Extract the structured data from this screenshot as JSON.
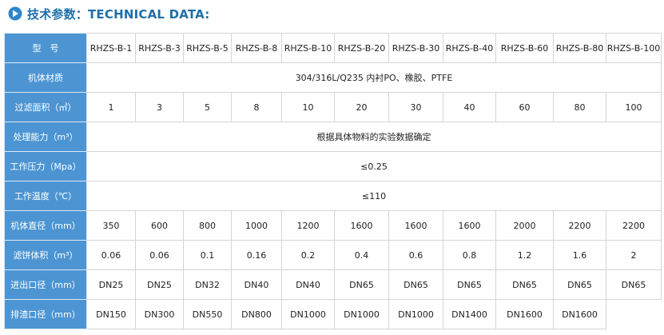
{
  "header": {
    "title": "技术参数：TECHNICAL DATA:",
    "icon": "arrow-right-circle-icon",
    "accent_color": "#1e6fa8"
  },
  "table": {
    "label_bg": "#4d95d2",
    "rows": [
      {
        "label": "型　号",
        "span": false,
        "values": [
          "RHZS-B-1",
          "RHZS-B-3",
          "RHZS-B-5",
          "RHZS-B-8",
          "RHZS-B-10",
          "RHZS-B-20",
          "RHZS-B-30",
          "RHZS-B-40",
          "RHZS-B-60",
          "RHZS-B-80",
          "RHZS-B-100"
        ]
      },
      {
        "label": "机体材质",
        "span": true,
        "value": "304/316L/Q235  内衬PO、橡胶、PTFE"
      },
      {
        "label": "过滤面积（㎡）",
        "span": false,
        "values": [
          "1",
          "3",
          "5",
          "8",
          "10",
          "20",
          "30",
          "40",
          "60",
          "80",
          "100"
        ]
      },
      {
        "label": "处理能力（m³）",
        "span": true,
        "value": "根据具体物料的实验数据确定"
      },
      {
        "label": "工作压力（Mpa）",
        "span": true,
        "value": "≤0.25"
      },
      {
        "label": "工作温度（℃）",
        "span": true,
        "value": "≤110"
      },
      {
        "label": "机体直径（mm）",
        "span": false,
        "values": [
          "350",
          "600",
          "800",
          "1000",
          "1200",
          "1600",
          "1600",
          "1600",
          "2000",
          "2200",
          "2200"
        ]
      },
      {
        "label": "滤饼体积（m³）",
        "span": false,
        "values": [
          "0.06",
          "0.06",
          "0.1",
          "0.16",
          "0.2",
          "0.4",
          "0.6",
          "0.8",
          "1.2",
          "1.6",
          "2"
        ]
      },
      {
        "label": "进出口径（mm）",
        "span": false,
        "values": [
          "DN25",
          "DN25",
          "DN32",
          "DN40",
          "DN40",
          "DN65",
          "DN65",
          "DN65",
          "DN65",
          "DN65",
          "DN65"
        ]
      },
      {
        "label": "排渣口径（mm）",
        "span": false,
        "values": [
          "DN150",
          "DN300",
          "DN550",
          "DN800",
          "DN1000",
          "DN1000",
          "DN1000",
          "DN1400",
          "DN1600",
          "DN1600"
        ]
      }
    ]
  }
}
